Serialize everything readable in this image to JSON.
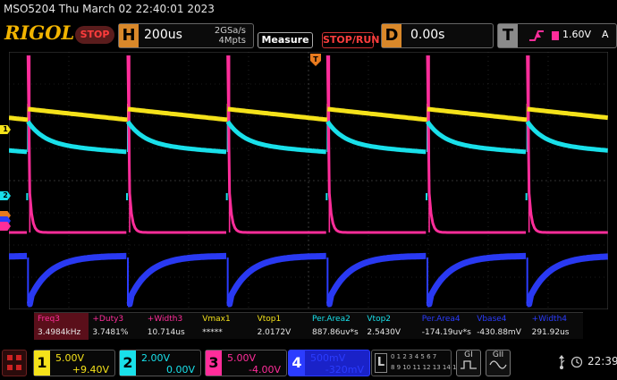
{
  "header": {
    "model_datetime": "MSO5204  Thu March 02 22:40:01 2023",
    "brand": "RIGOL",
    "run_state": "STOP",
    "timebase": {
      "letter": "H",
      "value": "200us",
      "sample_rate": "2GSa/s",
      "memory_depth": "4Mpts"
    },
    "measure_label": "Measure",
    "stoprun_label": "STOP/RUN",
    "delay": {
      "letter": "D",
      "value": "0.00s"
    },
    "trigger": {
      "letter": "T",
      "level": "1.60V",
      "mode": "A"
    }
  },
  "markers": {
    "ch1": "1",
    "ch2": "2"
  },
  "measurements": [
    {
      "label": "Freq3",
      "value": "3.4984kHz",
      "color": "#ff2d9a",
      "highlight": true
    },
    {
      "label": "+Duty3",
      "value": "3.7481%",
      "color": "#ff2d9a"
    },
    {
      "label": "+Width3",
      "value": "10.714us",
      "color": "#ff2d9a"
    },
    {
      "label": "Vmax1",
      "value": "*****",
      "color": "#f5e21a"
    },
    {
      "label": "Vtop1",
      "value": "2.0172V",
      "color": "#f5e21a"
    },
    {
      "label": "Per.Area2",
      "value": "887.86uv*s",
      "color": "#19e0ea"
    },
    {
      "label": "Vtop2",
      "value": "2.5430V",
      "color": "#19e0ea"
    },
    {
      "label": "Per.Area4",
      "value": "-174.19uv*s",
      "color": "#2b3cff"
    },
    {
      "label": "Vbase4",
      "value": "-430.88mV",
      "color": "#2b3cff"
    },
    {
      "label": "+Width4",
      "value": "291.92us",
      "color": "#2b3cff"
    }
  ],
  "channels": [
    {
      "num": "1",
      "scale": "5.00V",
      "offset": "+9.40V",
      "color": "#f5e21a"
    },
    {
      "num": "2",
      "scale": "2.00V",
      "offset": "0.00V",
      "color": "#19e0ea"
    },
    {
      "num": "3",
      "scale": "5.00V",
      "offset": "-4.00V",
      "color": "#ff2d9a"
    },
    {
      "num": "4",
      "scale": "500mV",
      "offset": "-320mV",
      "color": "#2b3cff"
    }
  ],
  "logic": {
    "letter": "L",
    "row1": "0 1 2 3 4 5 6 7",
    "row2": "8 9 10 11 12 13 14 15"
  },
  "buttons": {
    "g1": "GI",
    "g2": "GII"
  },
  "status": {
    "time": "22:39"
  },
  "colors": {
    "ch1": "#f5e21a",
    "ch2": "#19e0ea",
    "ch3": "#ff2d9a",
    "ch4": "#2b3cff",
    "trigger_marker": "#e87a1e"
  },
  "waveform": {
    "periods": 6,
    "horizontal_divisions": 10,
    "vertical_divisions": 8
  }
}
